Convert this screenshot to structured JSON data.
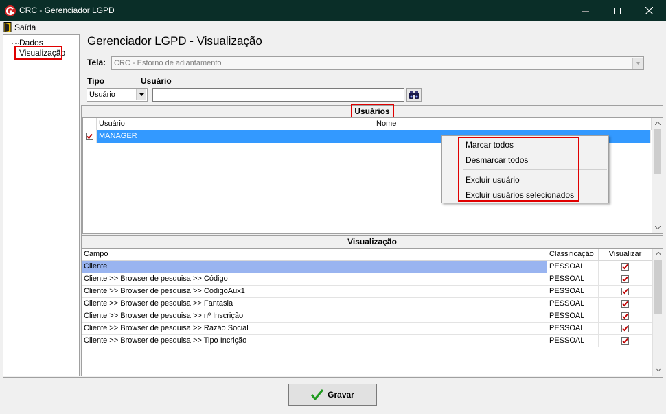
{
  "window": {
    "title": "CRC - Gerenciador LGPD",
    "icons": {
      "app": "crc-logo-icon",
      "minimize": "minimize-icon",
      "maximize": "maximize-icon",
      "close": "close-icon"
    }
  },
  "menu": {
    "exit_label": "Saída",
    "exit_icon": "exit-door-icon"
  },
  "tree": {
    "items": [
      {
        "label": "Dados"
      },
      {
        "label": "Visualização",
        "selected": true
      }
    ]
  },
  "header": {
    "title": "Gerenciador LGPD - Visualização"
  },
  "form": {
    "tela_label": "Tela:",
    "tela_value": "CRC - Estorno de adiantamento",
    "tipo_label": "Tipo",
    "tipo_value": "Usuário",
    "usuario_label": "Usuário",
    "usuario_value": "",
    "search_icon": "binoculars-icon"
  },
  "users_panel": {
    "title": "Usuários",
    "columns": [
      "Usuário",
      "Nome"
    ],
    "rows": [
      {
        "usuario": "MANAGER",
        "nome": "",
        "checked": true,
        "selected": true
      }
    ]
  },
  "context_menu": {
    "items": [
      "Marcar todos",
      "Desmarcar todos",
      "Excluir usuário",
      "Excluir usuários selecionados"
    ]
  },
  "view_panel": {
    "title": "Visualização",
    "columns": [
      "Campo",
      "Classificação",
      "Visualizar"
    ],
    "rows": [
      {
        "campo": "Cliente",
        "classificacao": "PESSOAL",
        "visualizar": true,
        "selected": true
      },
      {
        "campo": "Cliente >> Browser de pesquisa >> Código",
        "classificacao": "PESSOAL",
        "visualizar": true
      },
      {
        "campo": "Cliente >> Browser de pesquisa >> CodigoAux1",
        "classificacao": "PESSOAL",
        "visualizar": true
      },
      {
        "campo": "Cliente >> Browser de pesquisa >> Fantasia",
        "classificacao": "PESSOAL",
        "visualizar": true
      },
      {
        "campo": "Cliente >> Browser de pesquisa >> nº Inscrição",
        "classificacao": "PESSOAL",
        "visualizar": true
      },
      {
        "campo": "Cliente >> Browser de pesquisa >> Razão Social",
        "classificacao": "PESSOAL",
        "visualizar": true
      },
      {
        "campo": "Cliente >> Browser de pesquisa >> Tipo Incrição",
        "classificacao": "PESSOAL",
        "visualizar": true
      }
    ]
  },
  "footer": {
    "save_label": "Gravar",
    "save_icon": "checkmark-icon"
  },
  "colors": {
    "titlebar": "#0a2e28",
    "selection": "#3399ff",
    "selection_inactive": "#99b4f0",
    "highlight_box": "#e00000",
    "check": "#c00000",
    "save_check": "#1e9a1e"
  }
}
